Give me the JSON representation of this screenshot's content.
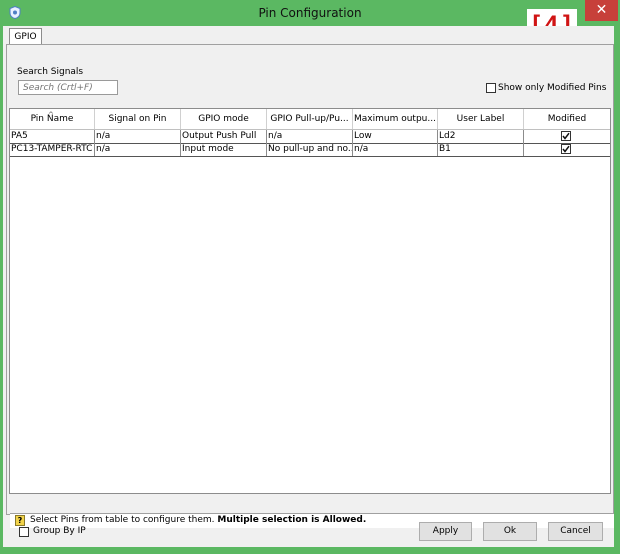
{
  "window": {
    "title": "Pin Configuration",
    "close_glyph": "✕",
    "stamp_text": "[4]"
  },
  "tabs": [
    {
      "label": "GPIO"
    }
  ],
  "search": {
    "label": "Search Signals",
    "placeholder": "Search (Crtl+F)",
    "value": ""
  },
  "show_modified": {
    "label": "Show only Modified Pins",
    "checked": false
  },
  "table": {
    "columns": [
      "Pin Name",
      "Signal on Pin",
      "GPIO mode",
      "GPIO Pull-up/Pu...",
      "Maximum outpu...",
      "User Label",
      "Modified"
    ],
    "rows": [
      {
        "pin": "PA5",
        "signal": "n/a",
        "mode": "Output Push Pull",
        "pull": "n/a",
        "speed": "Low",
        "label": "Ld2",
        "modified": true
      },
      {
        "pin": "PC13-TAMPER-RTC",
        "signal": "n/a",
        "mode": "Input mode",
        "pull": "No pull-up and no...",
        "speed": "n/a",
        "label": "B1",
        "modified": true
      }
    ]
  },
  "status": {
    "icon": "help-icon",
    "text": "Select Pins from table to configure them.",
    "bold_text": "Multiple selection is Allowed."
  },
  "footer": {
    "group_by_label": "Group By IP",
    "group_by_checked": false,
    "apply": "Apply",
    "ok": "Ok",
    "cancel": "Cancel"
  },
  "colors": {
    "title_bar": "#5bb862",
    "close_button": "#c7403a",
    "stamp": "#d01414",
    "dialog_bg": "#f0f0f0"
  }
}
